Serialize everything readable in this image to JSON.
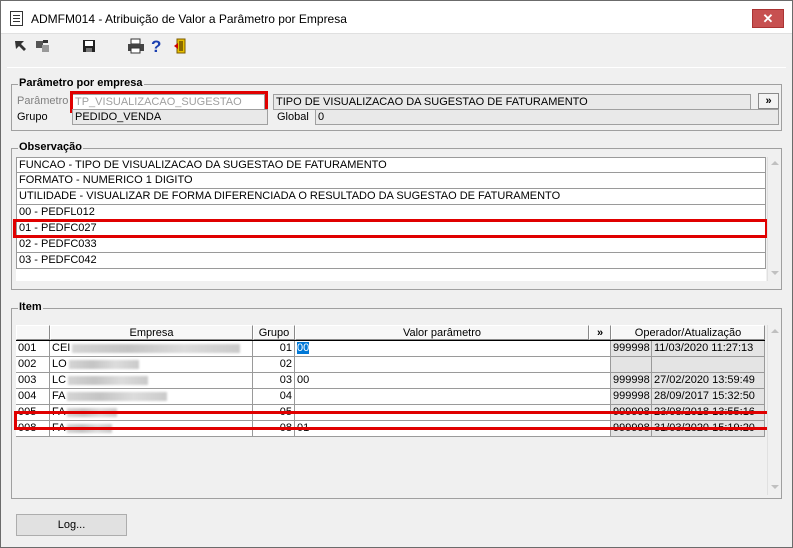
{
  "window": {
    "title": "ADMFM014 - Atribuição de Valor a Parâmetro por Empresa",
    "close_glyph": "✕"
  },
  "toolbar": {
    "icons": [
      "first-record-icon",
      "copy-records-icon",
      "save-icon",
      "print-icon",
      "help-icon",
      "exit-icon"
    ],
    "help_glyph": "?"
  },
  "param_group": {
    "title": "Parâmetro por empresa",
    "parametro_label": "Parâmetro",
    "parametro_value": "TP_VISUALIZACAO_SUGESTAO",
    "descricao_value": "TIPO DE VISUALIZACAO DA SUGESTAO DE FATURAMENTO",
    "lookup_button": "»",
    "grupo_label": "Grupo",
    "grupo_value": "PEDIDO_VENDA",
    "global_label": "Global",
    "global_value": "0"
  },
  "obs_group": {
    "title": "Observação",
    "lines": [
      "FUNCAO - TIPO DE VISUALIZACAO DA SUGESTAO DE FATURAMENTO",
      "FORMATO - NUMERICO 1 DIGITO",
      "UTILIDADE - VISUALIZAR DE FORMA DIFERENCIADA O RESULTADO DA SUGESTAO DE FATURAMENTO",
      "00 - PEDFL012",
      "01 - PEDFC027",
      "02 - PEDFC033",
      "03 - PEDFC042"
    ]
  },
  "item_group": {
    "title": "Item",
    "columns": {
      "empresa": "Empresa",
      "grupo": "Grupo",
      "valor": "Valor parâmetro",
      "valor_btn": "»",
      "operador": "Operador/Atualização"
    },
    "rows": [
      {
        "cod": "001",
        "empresa": "CEI",
        "grupo": "01",
        "valor": "00",
        "operador": "999998",
        "data": "11/03/2020 11:27:13"
      },
      {
        "cod": "002",
        "empresa": "LO",
        "grupo": "02",
        "valor": "",
        "operador": "",
        "data": ""
      },
      {
        "cod": "003",
        "empresa": "LC",
        "grupo": "03",
        "valor": "00",
        "operador": "999998",
        "data": "27/02/2020 13:59:49"
      },
      {
        "cod": "004",
        "empresa": "FA",
        "grupo": "04",
        "valor": "",
        "operador": "999998",
        "data": "28/09/2017 15:32:50"
      },
      {
        "cod": "005",
        "empresa": "FA",
        "grupo": "05",
        "valor": "",
        "operador": "999998",
        "data": "23/08/2018 13:55:16"
      },
      {
        "cod": "008",
        "empresa": "FA",
        "grupo": "08",
        "valor": "01",
        "operador": "999998",
        "data": "31/03/2020 15:19:20"
      }
    ]
  },
  "footer": {
    "log_button": "Log..."
  },
  "colors": {
    "highlight": "#e00000",
    "selection": "#0078d7",
    "close_button": "#c75050"
  }
}
